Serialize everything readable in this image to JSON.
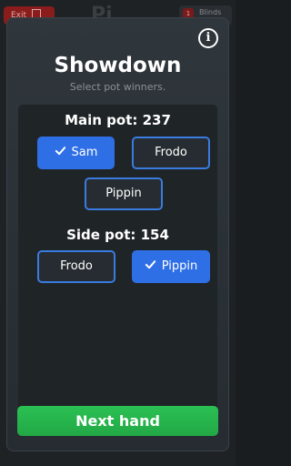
{
  "background": {
    "exit_label": "Exit",
    "title_partial": "Pi",
    "blinds_label": "Blinds",
    "blinds_badge": "1"
  },
  "modal": {
    "title": "Showdown",
    "subtitle": "Select pot winners.",
    "info_glyph": "i"
  },
  "pots": [
    {
      "heading": "Main pot: 237",
      "players": [
        {
          "name": "Sam",
          "selected": true
        },
        {
          "name": "Frodo",
          "selected": false
        },
        {
          "name": "Pippin",
          "selected": false
        }
      ]
    },
    {
      "heading": "Side pot: 154",
      "players": [
        {
          "name": "Frodo",
          "selected": false
        },
        {
          "name": "Pippin",
          "selected": true
        }
      ]
    }
  ],
  "actions": {
    "next_label": "Next hand"
  },
  "colors": {
    "accent_blue": "#2f6fe6",
    "confirm_green": "#22a846",
    "exit_red": "#8a1c1c"
  }
}
